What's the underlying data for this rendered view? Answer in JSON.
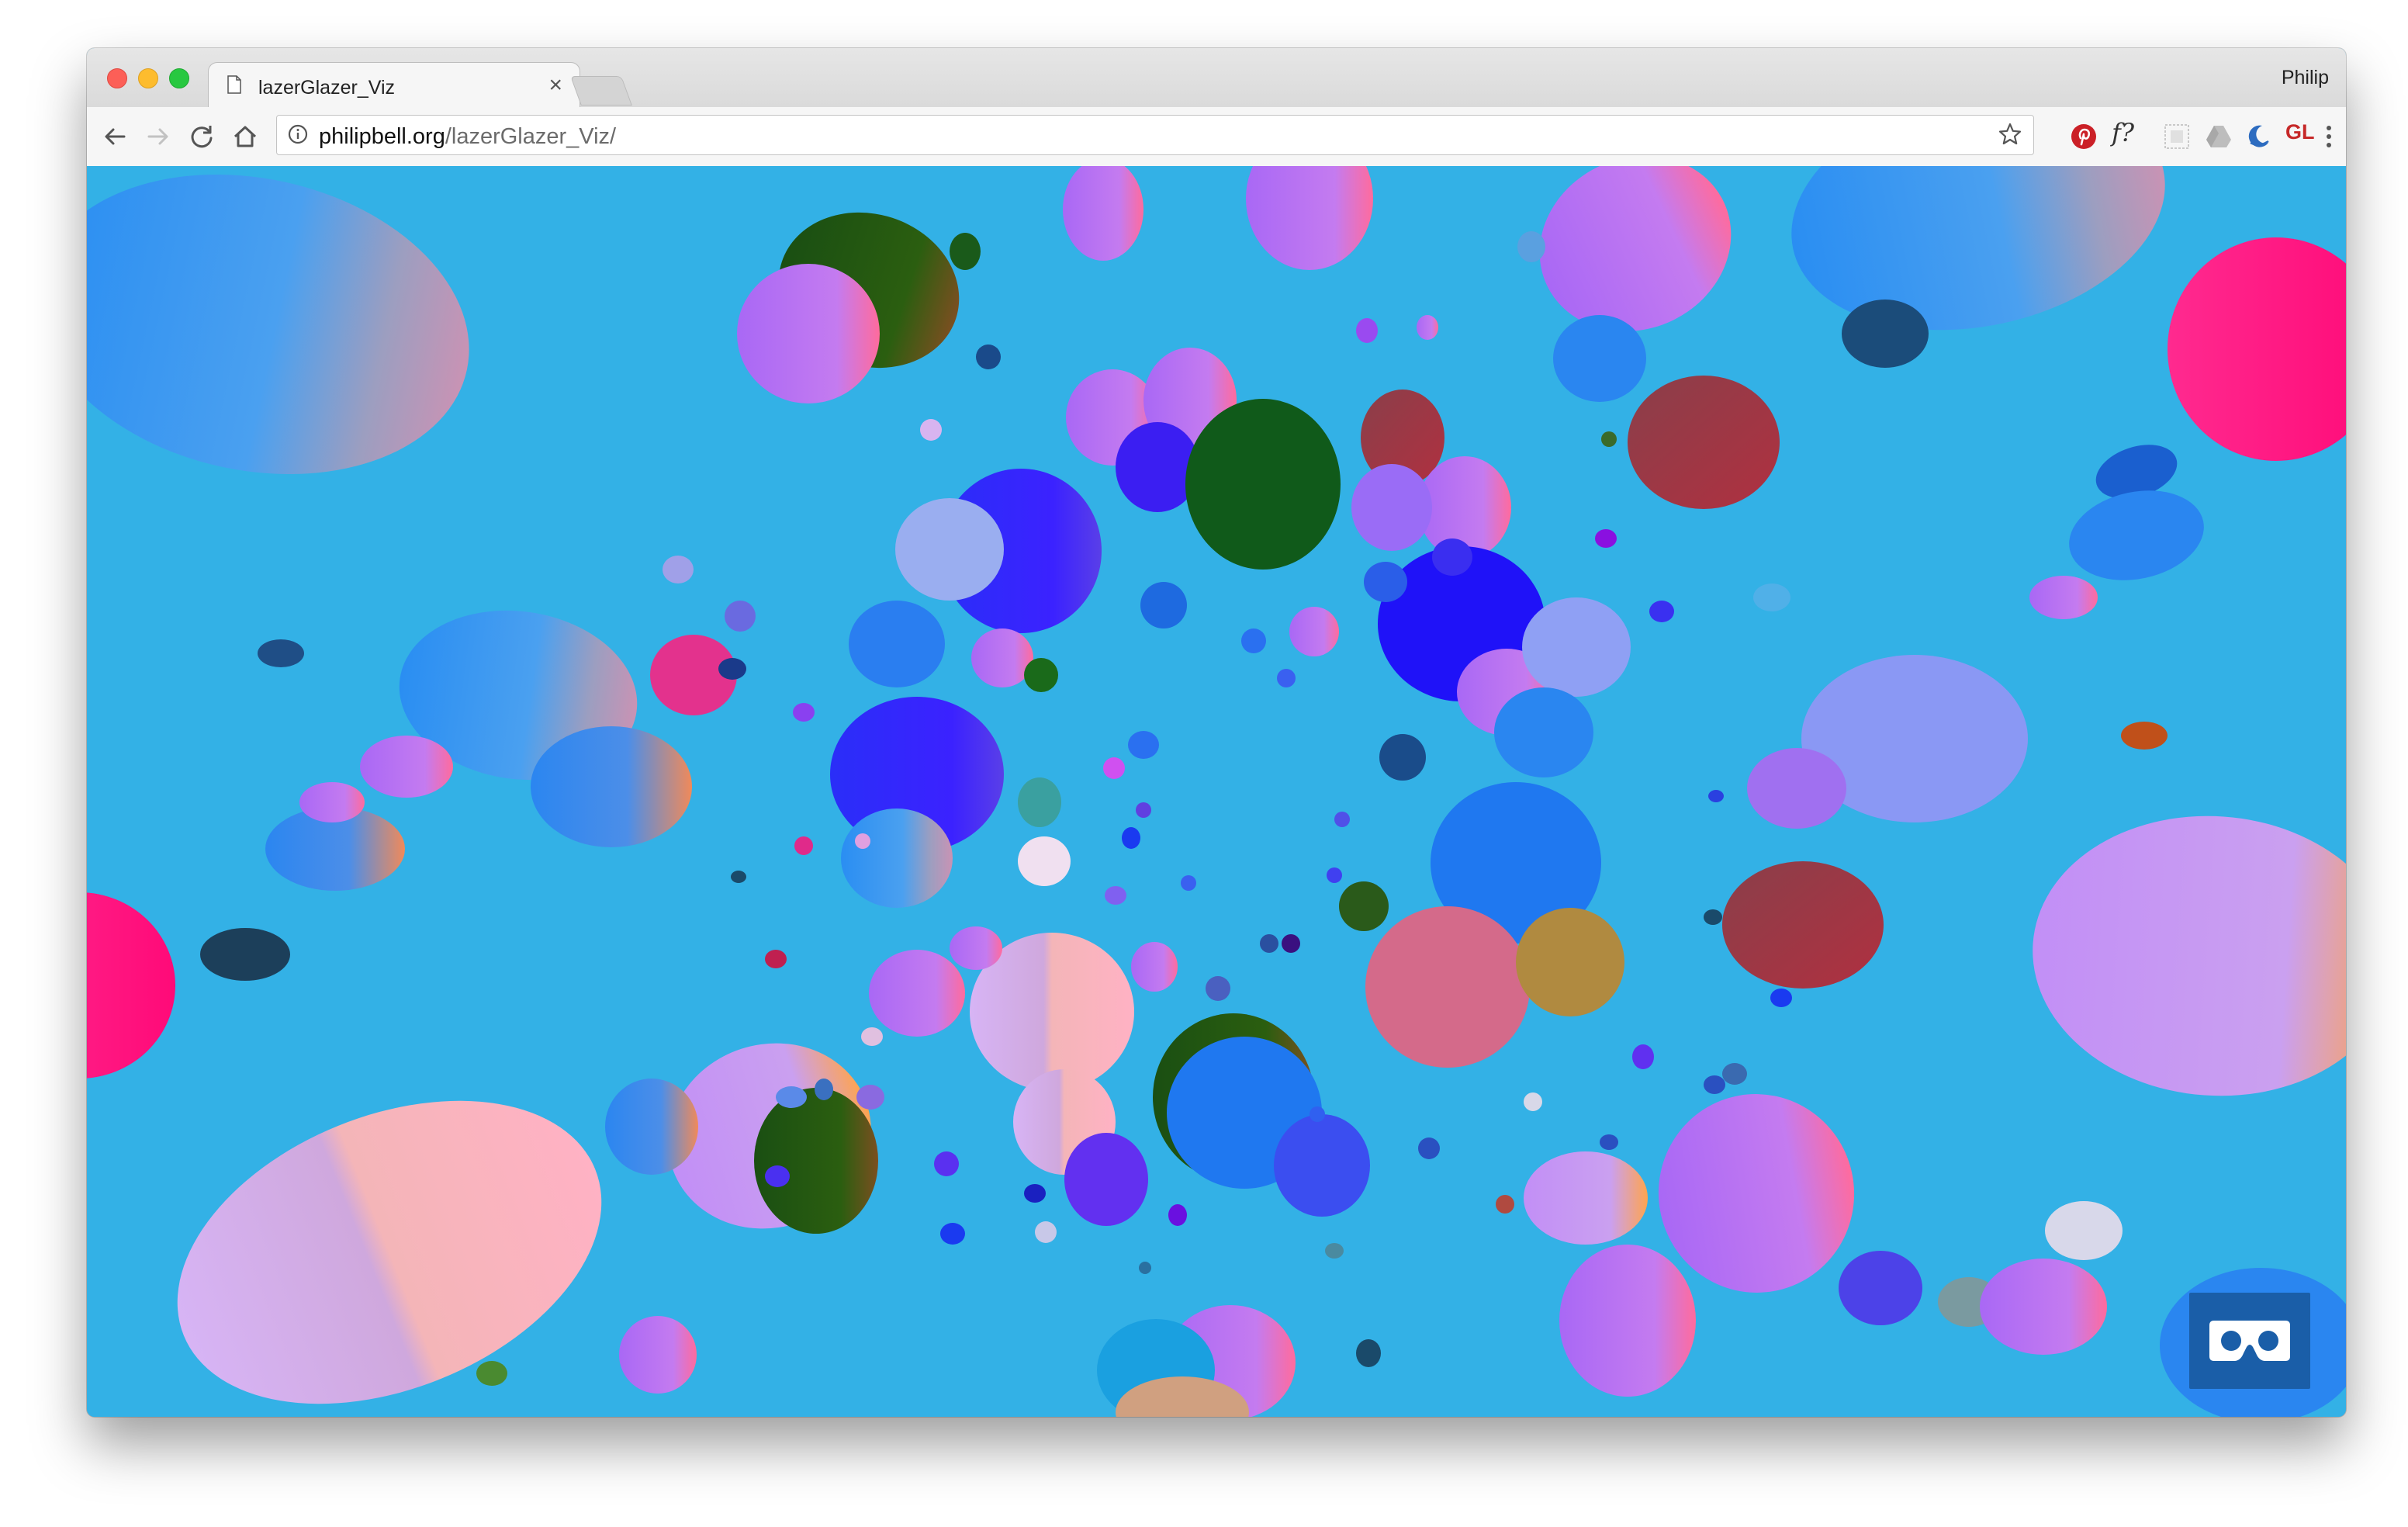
{
  "browser": {
    "tab_title": "lazerGlazer_Viz",
    "tab_close_glyph": "×",
    "profile_name": "Philip",
    "url_host": "philipbell.org",
    "url_path": "/lazerGlazer_Viz/",
    "icons": {
      "back": "arrow-left-icon",
      "forward": "arrow-right-icon",
      "reload": "reload-icon",
      "home": "home-icon",
      "site_info": "info-icon",
      "bookmark": "star-icon"
    },
    "extensions": [
      {
        "name": "pinterest-icon",
        "color": "#cb2027"
      },
      {
        "name": "font-finder-icon",
        "label": "f?",
        "color": "#333333"
      },
      {
        "name": "grid-extension-icon",
        "color": "#c9c9c9"
      },
      {
        "name": "drive-icon",
        "color": "#bdbdbd"
      },
      {
        "name": "crescent-extension-icon",
        "color": "#2d6cc0"
      },
      {
        "name": "gl-extension-icon",
        "label": "GL",
        "color": "#c62828"
      },
      {
        "name": "menu-dots-icon",
        "color": "#555555"
      }
    ]
  },
  "page": {
    "background_color": "#33b1e6",
    "vr_button_icon": "vr-headset-icon",
    "vr_button_color": "#1a5ea8"
  }
}
